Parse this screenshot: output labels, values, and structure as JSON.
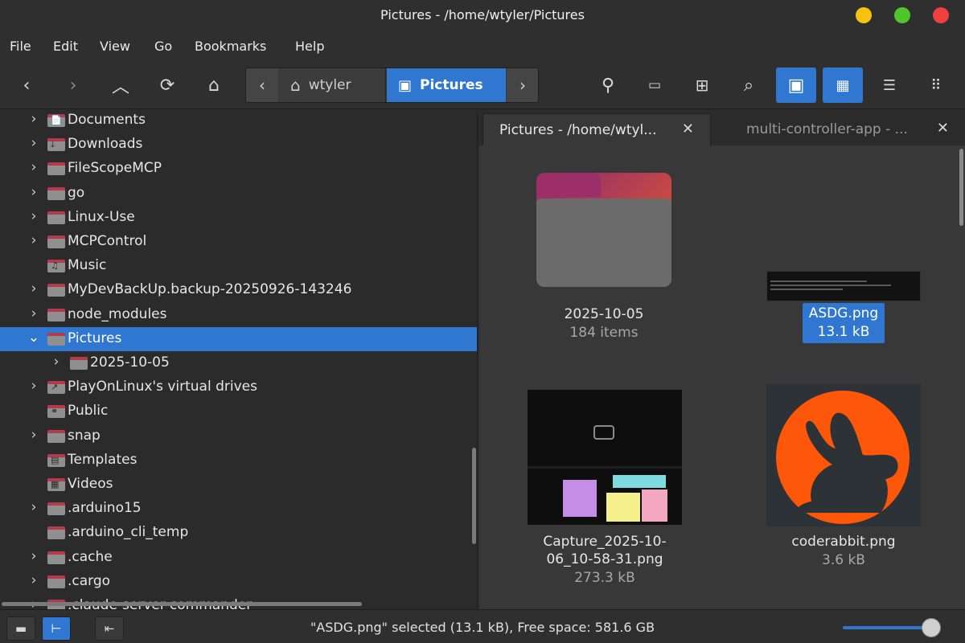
{
  "window": {
    "title": "Pictures - /home/wtyler/Pictures",
    "colors": {
      "minimize": "#f5c211",
      "maximize": "#4ec52d",
      "close": "#ef3f3f",
      "accent": "#2f77d1"
    }
  },
  "menu": [
    "File",
    "Edit",
    "View",
    "Go",
    "Bookmarks",
    "Help"
  ],
  "toolbar": {
    "icons": [
      "back-icon",
      "forward-icon",
      "up-icon",
      "reload-icon",
      "home-icon",
      "location-icon",
      "terminal-icon",
      "new-folder-icon",
      "search-icon",
      "picture-view-icon",
      "icon-view-icon",
      "list-view-icon",
      "compact-view-icon"
    ],
    "path": {
      "home": "wtyler",
      "current": "Pictures"
    }
  },
  "sidebar": {
    "items": [
      {
        "label": "Documents",
        "expandable": true,
        "depth": 0,
        "glyph": "📄"
      },
      {
        "label": "Downloads",
        "expandable": true,
        "depth": 0,
        "glyph": "⤓"
      },
      {
        "label": "FileScopeMCP",
        "expandable": true,
        "depth": 0,
        "glyph": ""
      },
      {
        "label": "go",
        "expandable": true,
        "depth": 0,
        "glyph": ""
      },
      {
        "label": "Linux-Use",
        "expandable": true,
        "depth": 0,
        "glyph": ""
      },
      {
        "label": "MCPControl",
        "expandable": true,
        "depth": 0,
        "glyph": ""
      },
      {
        "label": "Music",
        "expandable": false,
        "depth": 0,
        "glyph": "♫"
      },
      {
        "label": "MyDevBackUp.backup-20250926-143246",
        "expandable": true,
        "depth": 0,
        "glyph": ""
      },
      {
        "label": "node_modules",
        "expandable": true,
        "depth": 0,
        "glyph": ""
      },
      {
        "label": "Pictures",
        "expandable": true,
        "expanded": true,
        "selected": true,
        "depth": 0,
        "glyph": ""
      },
      {
        "label": "2025-10-05",
        "expandable": true,
        "depth": 1,
        "glyph": ""
      },
      {
        "label": "PlayOnLinux's virtual drives",
        "expandable": true,
        "depth": 0,
        "glyph": "↗"
      },
      {
        "label": "Public",
        "expandable": false,
        "depth": 0,
        "glyph": "⚭"
      },
      {
        "label": "snap",
        "expandable": true,
        "depth": 0,
        "glyph": ""
      },
      {
        "label": "Templates",
        "expandable": false,
        "depth": 0,
        "glyph": "▤"
      },
      {
        "label": "Videos",
        "expandable": false,
        "depth": 0,
        "glyph": "▦"
      },
      {
        "label": ".arduino15",
        "expandable": true,
        "depth": 0,
        "glyph": ""
      },
      {
        "label": ".arduino_cli_temp",
        "expandable": false,
        "depth": 0,
        "glyph": ""
      },
      {
        "label": ".cache",
        "expandable": true,
        "depth": 0,
        "glyph": ""
      },
      {
        "label": ".cargo",
        "expandable": true,
        "depth": 0,
        "glyph": ""
      },
      {
        "label": ".claude-server-commander",
        "expandable": true,
        "depth": 0,
        "glyph": ""
      }
    ]
  },
  "tabs": [
    {
      "label": "Pictures - /home/wtyl...",
      "active": true
    },
    {
      "label": "multi-controller-app - ...",
      "active": false
    }
  ],
  "files": [
    {
      "name": "2025-10-05",
      "sub": "184 items",
      "kind": "folder"
    },
    {
      "name": "ASDG.png",
      "sub": "13.1 kB",
      "kind": "image",
      "selected": true
    },
    {
      "name": "Capture_2025-10-06_10-58-31.png",
      "name_line1": "Capture_2025-10-",
      "name_line2": "06_10-58-31.png",
      "sub": "273.3 kB",
      "kind": "image"
    },
    {
      "name": "coderabbit.png",
      "sub": "3.6 kB",
      "kind": "image"
    }
  ],
  "status": {
    "text": "\"ASDG.png\" selected (13.1 kB), Free space: 581.6 GB",
    "zoom_fraction": 0.88
  }
}
